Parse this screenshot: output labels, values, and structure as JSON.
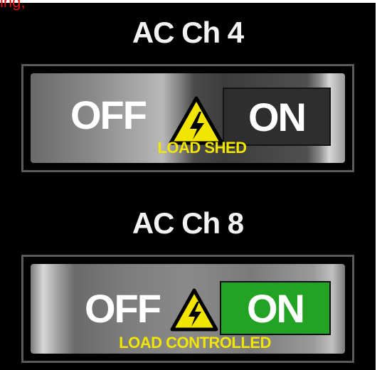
{
  "clipped_top_text": "ing,",
  "channels": [
    {
      "title": "AC Ch 4",
      "off_label": "OFF",
      "on_label": "ON",
      "state": "on",
      "status_label": "LOAD SHED",
      "on_indicator_color": "#2e2e2e",
      "warning_icon": "high-voltage-warning-icon"
    },
    {
      "title": "AC Ch 8",
      "off_label": "OFF",
      "on_label": "ON",
      "state": "on",
      "status_label": "LOAD CONTROLLED",
      "on_indicator_color": "#23a323",
      "warning_icon": "high-voltage-warning-icon"
    }
  ],
  "colors": {
    "status_label": "#f2e600",
    "clipped_text": "#e01010"
  }
}
